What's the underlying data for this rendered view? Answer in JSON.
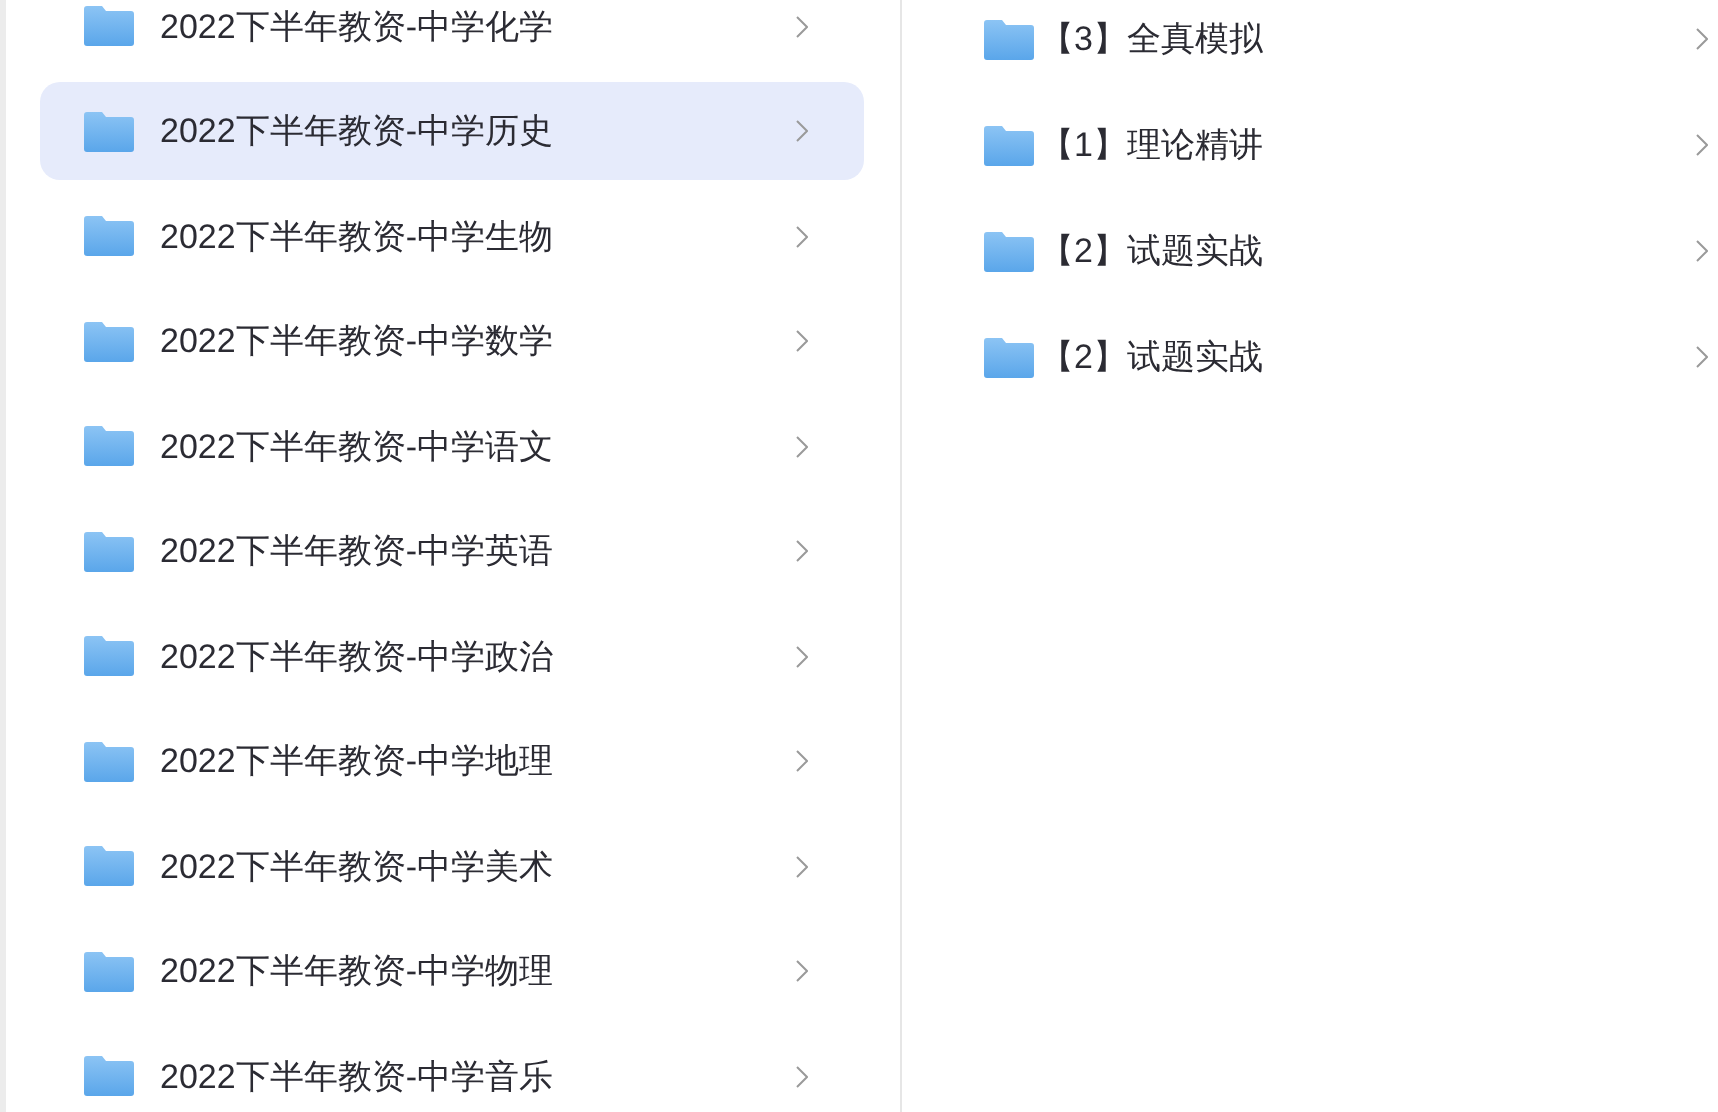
{
  "folders": [
    {
      "name": "2022下半年教资-中学化学",
      "selected": false
    },
    {
      "name": "2022下半年教资-中学历史",
      "selected": true
    },
    {
      "name": "2022下半年教资-中学生物",
      "selected": false
    },
    {
      "name": "2022下半年教资-中学数学",
      "selected": false
    },
    {
      "name": "2022下半年教资-中学语文",
      "selected": false
    },
    {
      "name": "2022下半年教资-中学英语",
      "selected": false
    },
    {
      "name": "2022下半年教资-中学政治",
      "selected": false
    },
    {
      "name": "2022下半年教资-中学地理",
      "selected": false
    },
    {
      "name": "2022下半年教资-中学美术",
      "selected": false
    },
    {
      "name": "2022下半年教资-中学物理",
      "selected": false
    },
    {
      "name": "2022下半年教资-中学音乐",
      "selected": false
    }
  ],
  "subfolders": [
    {
      "name": "【3】全真模拟"
    },
    {
      "name": "【1】理论精讲"
    },
    {
      "name": "【2】试题实战"
    },
    {
      "name": "【2】试题实战"
    }
  ]
}
